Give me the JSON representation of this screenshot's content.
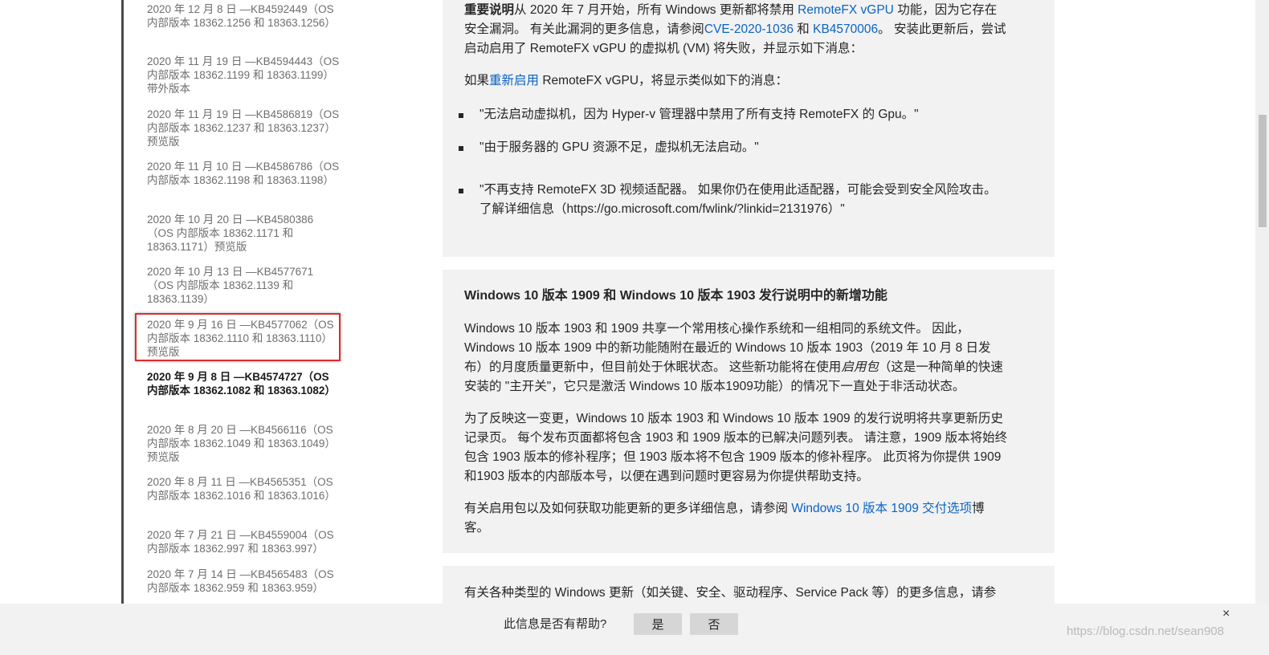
{
  "sidebar": {
    "items": [
      {
        "label": "2020 年 12 月 8 日 —KB4592449（OS 内部版本 18362.1256 和 18363.1256）",
        "current": false
      },
      {
        "label": "2020 年 11 月 19 日 —KB4594443（OS 内部版本 18362.1199 和 18363.1199）带外版本",
        "current": false
      },
      {
        "label": "2020 年 11 月 19 日 —KB4586819（OS 内部版本 18362.1237 和 18363.1237）预览版",
        "current": false
      },
      {
        "label": "2020 年 11 月 10 日 —KB4586786（OS 内部版本 18362.1198 和 18363.1198）",
        "current": false
      },
      {
        "label": "2020 年 10 月 20 日 —KB4580386（OS 内部版本 18362.1171 和 18363.1171）预览版",
        "current": false
      },
      {
        "label": "2020 年 10 月 13 日 —KB4577671（OS 内部版本 18362.1139 和 18363.1139）",
        "current": false
      },
      {
        "label": "2020 年 9 月 16 日 —KB4577062（OS 内部版本 18362.1110 和 18363.1110）预览版",
        "current": false
      },
      {
        "label": "2020 年 9 月 8 日 —KB4574727（OS 内部版本 18362.1082 和 18363.1082）",
        "current": true
      },
      {
        "label": "2020 年 8 月 20 日 —KB4566116（OS 内部版本 18362.1049 和 18363.1049）预览版",
        "current": false
      },
      {
        "label": "2020 年 8 月 11 日 —KB4565351（OS 内部版本 18362.1016 和 18363.1016）",
        "current": false
      },
      {
        "label": "2020 年 7 月 21 日 —KB4559004（OS 内部版本 18362.997 和 18363.997）",
        "current": false
      },
      {
        "label": "2020 年 7 月 14 日 —KB4565483（OS 内部版本 18362.959 和 18363.959）",
        "current": false
      }
    ]
  },
  "important_card": {
    "bold_lead": "重要说明",
    "p1_a": "从 2020 年 7 月开始，所有 Windows 更新都将禁用 ",
    "p1_link1": "RemoteFX vGPU",
    "p1_b": " 功能，因为它存在安全漏洞。 有关此漏洞的更多信息，请参阅",
    "p1_link2": "CVE-2020-1036",
    "p1_c": " 和 ",
    "p1_link3": "KB4570006",
    "p1_d": "。 安装此更新后，尝试启动启用了 RemoteFX vGPU 的虚拟机 (VM) 将失败，并显示如下消息：",
    "p2_a": "如果",
    "p2_link": "重新启用",
    "p2_b": " RemoteFX vGPU，将显示类似如下的消息：",
    "bullets": [
      "\"无法启动虚拟机，因为 Hyper-v 管理器中禁用了所有支持 RemoteFX 的 Gpu。\"",
      "\"由于服务器的 GPU 资源不足，虚拟机无法启动。\"",
      "\"不再支持 RemoteFX 3D 视频适配器。 如果你仍在使用此适配器，可能会受到安全风险攻击。了解详细信息（https://go.microsoft.com/fwlink/?linkid=2131976）\""
    ]
  },
  "features_card": {
    "heading": "Windows 10 版本 1909 和 Windows 10 版本 1903 发行说明中的新增功能",
    "p1_a": "Windows 10 版本 1903 和 1909 共享一个常用核心操作系统和一组相同的系统文件。 因此，Windows 10 版本 1909 中的新功能随附在最近的 Windows 10 版本 1903（2019 年 10 月 8 日发布）的月度质量更新中，但目前处于休眠状态。 这些新功能将在使用",
    "p1_em": "启用包",
    "p1_b": "（这是一种简单的快速安装的 \"主开关\"，它只是激活 Windows 10 版本1909功能）的情况下一直处于非活动状态。",
    "p2": "为了反映这一变更，Windows 10 版本 1903 和 Windows 10 版本 1909 的发行说明将共享更新历史记录页。 每个发布页面都将包含 1903 和 1909 版本的已解决问题列表。 请注意，1909 版本将始终包含 1903 版本的修补程序；但 1903 版本将不包含 1909 版本的修补程序。 此页将为你提供 1909 和1903 版本的内部版本号，以便在遇到问题时更容易为你提供帮助支持。",
    "p3_a": "有关启用包以及如何获取功能更新的更多详细信息，请参阅 ",
    "p3_link": "Windows 10 版本 1909 交付选项",
    "p3_b": "博客。"
  },
  "types_card": {
    "text": "有关各种类型的 Windows 更新（如关键、安全、驱动程序、Service Pack 等）的更多信息，请参"
  },
  "feedback": {
    "question": "此信息是否有帮助?",
    "yes_label": "是",
    "no_label": "否",
    "close_glyph": "×"
  },
  "watermark": "https://blog.csdn.net/sean908"
}
